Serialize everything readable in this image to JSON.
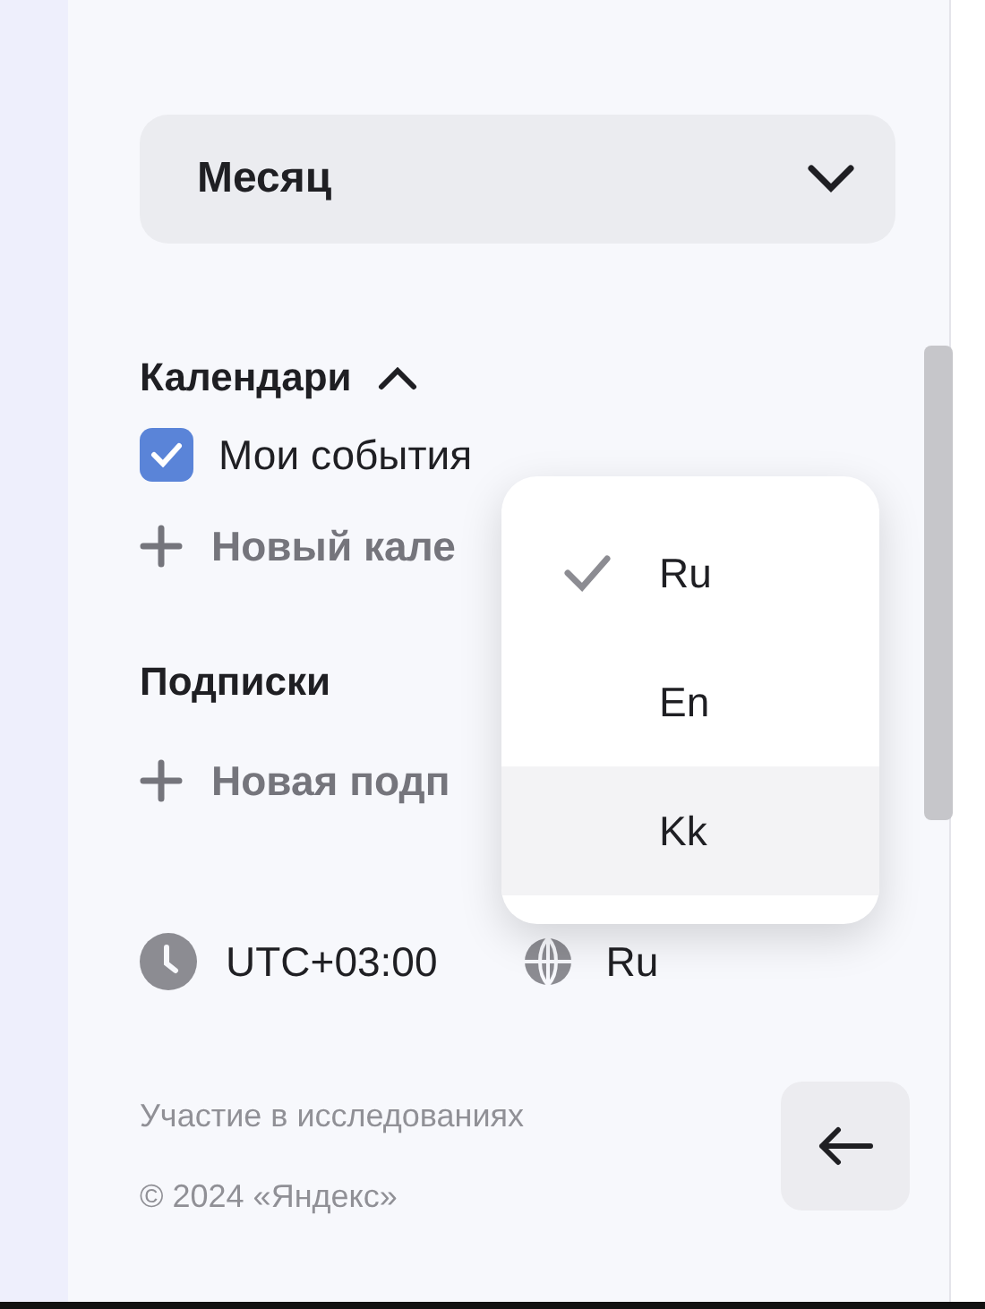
{
  "view_select": {
    "value": "Месяц"
  },
  "calendars": {
    "title": "Календари",
    "expanded": true,
    "items": [
      {
        "label": "Мои события",
        "checked": true
      }
    ],
    "add_label": "Новый кале"
  },
  "subscriptions": {
    "title": "Подписки",
    "add_label": "Новая подп"
  },
  "timezone": "UTC+03:00",
  "language": "Ru",
  "language_menu": [
    {
      "label": "Ru",
      "selected": true,
      "hovered": false
    },
    {
      "label": "En",
      "selected": false,
      "hovered": false
    },
    {
      "label": "Kk",
      "selected": false,
      "hovered": true
    }
  ],
  "footer": {
    "research_link": "Участие в исследованиях",
    "copyright": "© 2024 «Яндекс»"
  }
}
